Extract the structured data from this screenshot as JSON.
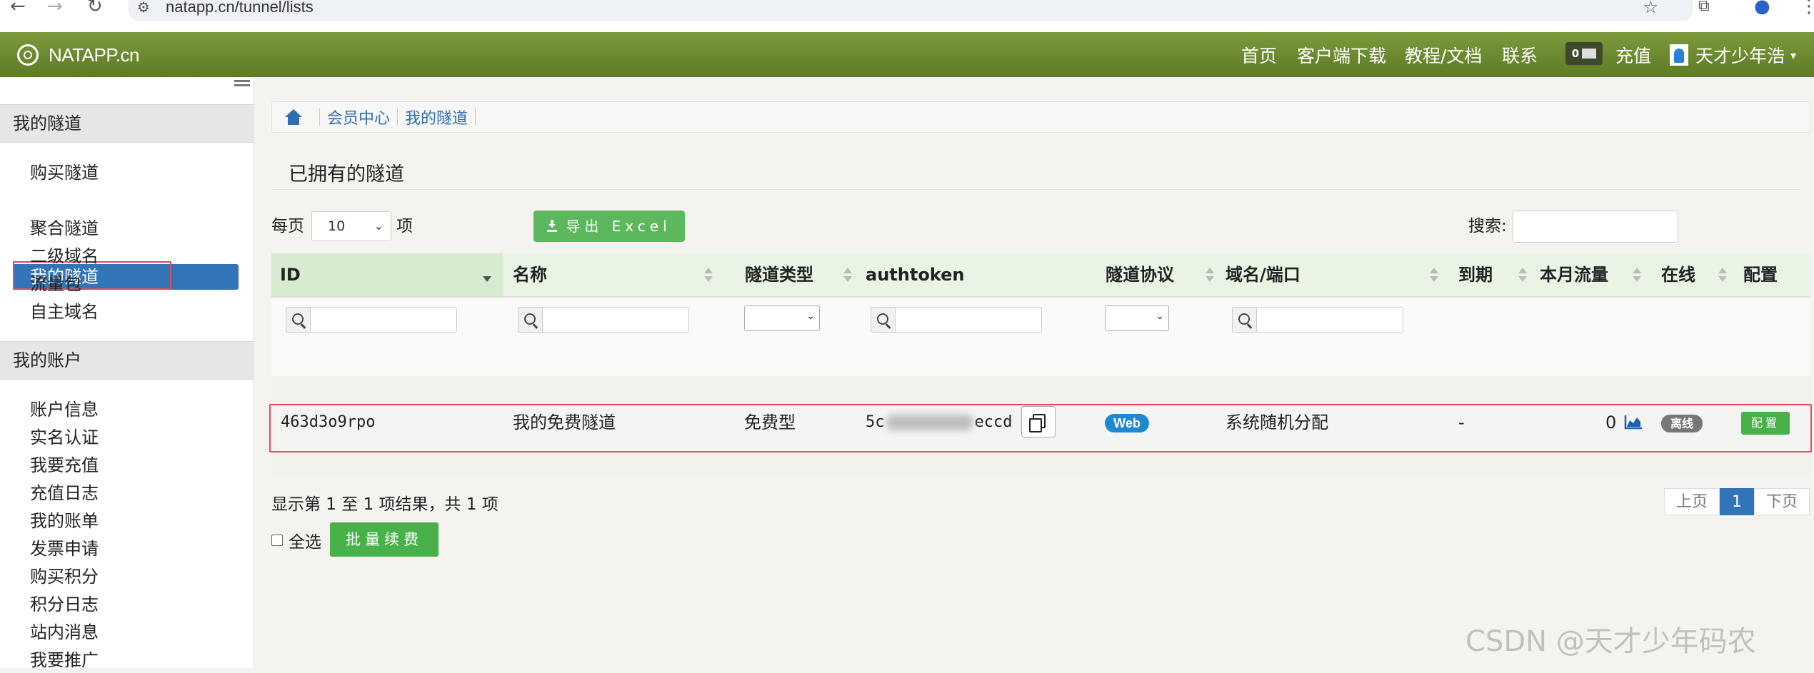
{
  "browser": {
    "url": "natapp.cn/tunnel/lists"
  },
  "header": {
    "brand": "NATAPP.cn",
    "nav": [
      "首页",
      "客户端下载",
      "教程/文档",
      "联系"
    ],
    "message_count": "0",
    "recharge": "充值",
    "username": "天才少年浩"
  },
  "sidebar": {
    "section1_title": "我的隧道",
    "section1_items": [
      "购买隧道",
      "我的隧道",
      "聚合隧道",
      "二级域名",
      "流量包",
      "自主域名"
    ],
    "section2_title": "我的账户",
    "section2_items": [
      "账户信息",
      "实名认证",
      "我要充值",
      "充值日志",
      "我的账单",
      "发票申请",
      "购买积分",
      "积分日志",
      "站内消息",
      "我要推广"
    ]
  },
  "breadcrumb": [
    "会员中心",
    "我的隧道"
  ],
  "page_title": "已拥有的隧道",
  "controls": {
    "per_page_prefix": "每页",
    "per_page_value": "10",
    "per_page_suffix": "项",
    "export_label": "导出 Excel",
    "search_label": "搜索:"
  },
  "table": {
    "columns": [
      "ID",
      "名称",
      "隧道类型",
      "authtoken",
      "隧道协议",
      "域名/端口",
      "到期",
      "本月流量",
      "在线",
      "配置"
    ],
    "rows": [
      {
        "id": "463d3o9rpo",
        "name": "我的免费隧道",
        "type": "免费型",
        "authtoken_start": "5c",
        "authtoken_end": "eccd",
        "protocol": "Web",
        "domain": "系统随机分配",
        "expire": "-",
        "traffic": "0",
        "online": "离线",
        "config": "配置"
      }
    ]
  },
  "footer": {
    "info": "显示第 1 至 1 项结果，共 1 项",
    "prev": "上页",
    "page": "1",
    "next": "下页",
    "select_all": "全选",
    "batch_renew": "批量续费"
  },
  "watermark": "CSDN @天才少年码农",
  "colors": {
    "header_green": "#6b8a2f",
    "active_blue": "#3174b8",
    "button_green": "#5cb85c",
    "highlight_red": "#e94a5e"
  }
}
